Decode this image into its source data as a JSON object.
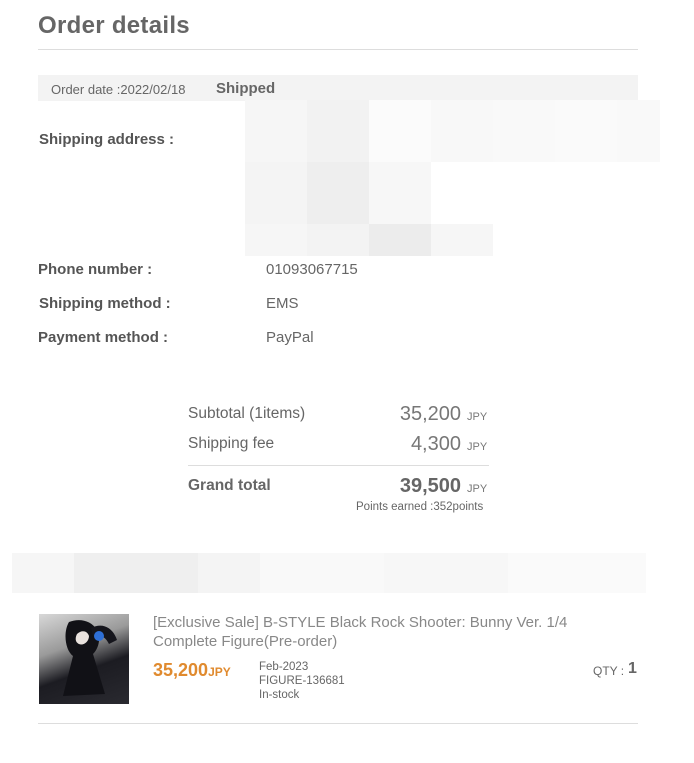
{
  "page": {
    "title": "Order details"
  },
  "order": {
    "date_text": "Order date :2022/02/18",
    "status": "Shipped"
  },
  "details": {
    "shipping_address_label": "Shipping address :",
    "phone_label": "Phone number :",
    "phone_value": "01093067715",
    "shipping_method_label": "Shipping method :",
    "shipping_method_value": "EMS",
    "payment_method_label": "Payment method :",
    "payment_method_value": "PayPal"
  },
  "summary": {
    "subtotal_label": "Subtotal (1items)",
    "subtotal_amount": "35,200",
    "shipping_label": "Shipping fee",
    "shipping_amount": "4,300",
    "grand_label": "Grand total",
    "grand_amount": "39,500",
    "currency": "JPY",
    "points_text": "Points earned :352points"
  },
  "product": {
    "name": "[Exclusive Sale] B-STYLE Black Rock Shooter: Bunny Ver. 1/4 Complete Figure(Pre-order)",
    "price": "35,200",
    "price_currency": "JPY",
    "release": "Feb-2023",
    "sku": "FIGURE-136681",
    "stock": "In-stock",
    "qty_label": "QTY :",
    "qty_value": "1"
  }
}
